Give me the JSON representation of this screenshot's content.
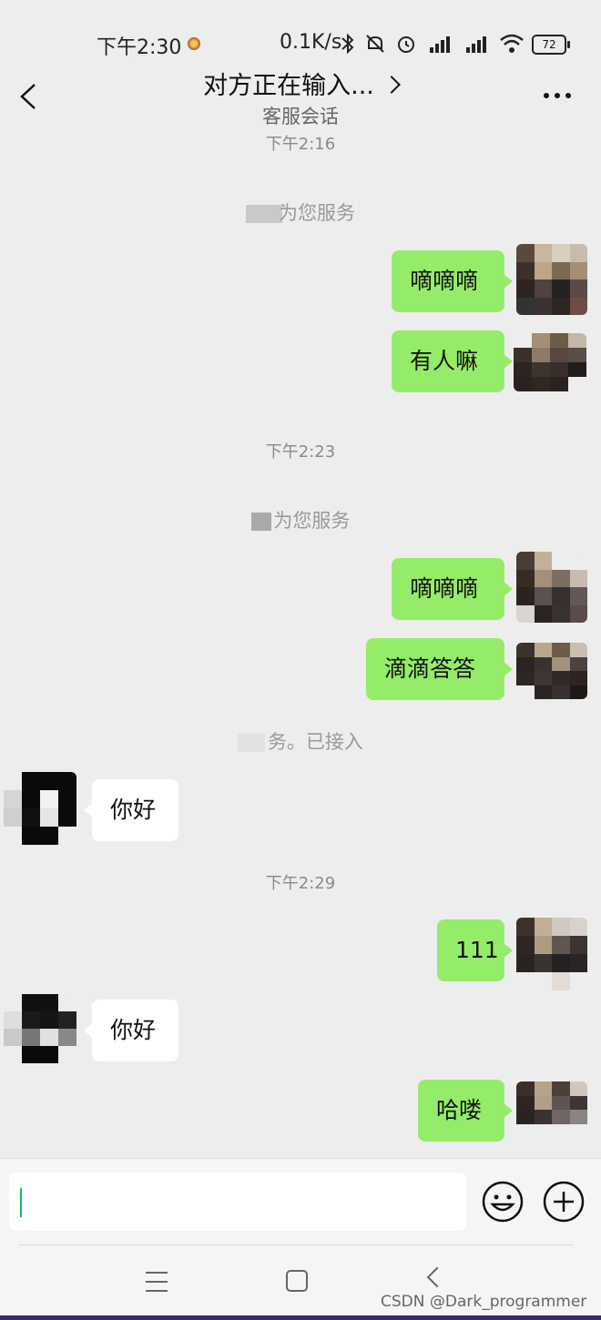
{
  "status_bar": {
    "time": "下午2:30",
    "speed": "0.1K/s",
    "battery": "72"
  },
  "header": {
    "title": "对方正在输入...",
    "subtitle": "客服会话"
  },
  "messages": {
    "ts1": "下午2:16",
    "sys1": "为您服务",
    "m1": "嘀嘀嘀",
    "m2": "有人嘛",
    "ts2": "下午2:23",
    "sys2": "为您服务",
    "m3": "嘀嘀嘀",
    "m4": "滴滴答答",
    "sys3": "务。已接入",
    "r1": "你好",
    "ts3": "下午2:29",
    "m5": "111",
    "r2": "你好",
    "m6": "哈喽"
  },
  "watermark": "CSDN @Dark_programmer",
  "colors": {
    "my_bubble": "#95ec69",
    "their_bubble": "#ffffff",
    "background": "#ededed",
    "caret": "#07c160"
  },
  "icons": [
    "back-icon",
    "chevron-right-icon",
    "more-icon",
    "bluetooth-icon",
    "mute-icon",
    "alarm-icon",
    "signal-icon",
    "wifi-icon",
    "battery-icon",
    "emoji-icon",
    "plus-icon",
    "menu-icon",
    "home-icon",
    "back-nav-icon"
  ]
}
